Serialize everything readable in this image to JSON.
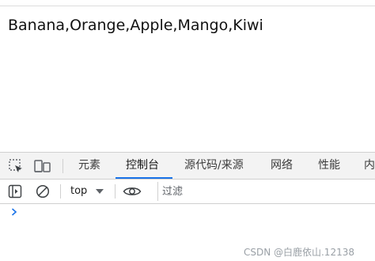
{
  "page": {
    "content_text": "Banana,Orange,Apple,Mango,Kiwi"
  },
  "devtools": {
    "tabs": [
      {
        "label": "元素",
        "active": false
      },
      {
        "label": "控制台",
        "active": true
      },
      {
        "label": "源代码/来源",
        "active": false
      },
      {
        "label": "网络",
        "active": false
      },
      {
        "label": "性能",
        "active": false
      },
      {
        "label": "内",
        "active": false
      }
    ],
    "icons": {
      "inspect": "element-picker-icon",
      "device": "device-toolbar-icon",
      "sidebar": "sidebar-toggle-icon",
      "clear": "clear-console-icon",
      "eye": "live-expression-icon",
      "prompt": "chevron-right-icon"
    },
    "toolbar": {
      "context": "top",
      "filter_placeholder": "过滤"
    },
    "accent_color": "#1a73e8"
  },
  "watermark": "CSDN @白鹿依山.12138"
}
